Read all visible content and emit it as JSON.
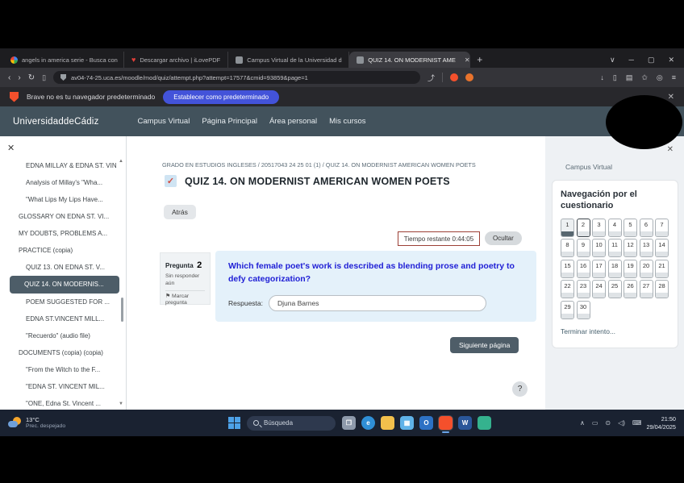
{
  "browser": {
    "tabs": [
      {
        "label": "angels in america serie - Busca con",
        "favicon": "google-favicon",
        "style": "google",
        "active": false
      },
      {
        "label": "Descargar archivo | iLovePDF",
        "favicon": "heart-favicon",
        "style": "heart",
        "active": false
      },
      {
        "label": "Campus Virtual de la Universidad d",
        "favicon": "moodle-favicon",
        "style": "moodle",
        "active": false
      },
      {
        "label": "QUIZ 14. ON MODERNIST AME",
        "favicon": "moodle-favicon",
        "style": "moodle",
        "active": true
      }
    ],
    "new_tab": "+",
    "window_controls": [
      "∨",
      "─",
      "▢",
      "✕"
    ],
    "nav": {
      "back": "‹",
      "forward": "›",
      "reload": "↻"
    },
    "url": "av04-74-25.uca.es/moodle/mod/quiz/attempt.php?attempt=17577&cmid=93859&page=1",
    "share_glyph": "⤴",
    "extensions": [
      {
        "name": "brave-extension-icon",
        "color": "#f4502c"
      },
      {
        "name": "extension-icon",
        "color": "#e8732c"
      }
    ],
    "right_icons": [
      {
        "name": "download-icon",
        "glyph": "↓"
      },
      {
        "name": "split-screen-icon",
        "glyph": "▯"
      },
      {
        "name": "collections-icon",
        "glyph": "▤"
      },
      {
        "name": "favorites-icon",
        "glyph": "✩"
      },
      {
        "name": "browser-essentials-icon",
        "glyph": "◎"
      },
      {
        "name": "menu-icon",
        "glyph": "≡"
      }
    ],
    "notification": {
      "text": "Brave no es tu navegador predeterminado",
      "button": "Establecer como predeterminado",
      "close": "✕"
    }
  },
  "site_header": {
    "logo": "UniversidaddeCádiz",
    "nav": [
      "Campus Virtual",
      "Página Principal",
      "Área personal",
      "Mis cursos"
    ]
  },
  "sidebar": {
    "close": "✕",
    "items": [
      {
        "label": "EDNA MILLAY & EDNA ST. VIN",
        "level": 2,
        "selected": false
      },
      {
        "label": "Analysis of Millay's \"Wha...",
        "level": 2,
        "selected": false
      },
      {
        "label": "\"What Lips My Lips Have...",
        "level": 2,
        "selected": false
      },
      {
        "label": "GLOSSARY ON EDNA ST. VI...",
        "level": 1,
        "selected": false
      },
      {
        "label": "MY DOUBTS, PROBLEMS A...",
        "level": 1,
        "selected": false
      },
      {
        "label": "PRACTICE (copia)",
        "level": 1,
        "selected": false
      },
      {
        "label": "QUIZ 13. ON EDNA ST. V...",
        "level": 2,
        "selected": false
      },
      {
        "label": "QUIZ 14. ON MODERNIS...",
        "level": 2,
        "selected": true
      },
      {
        "label": "POEM SUGGESTED FOR ...",
        "level": 2,
        "selected": false
      },
      {
        "label": "EDNA ST.VINCENT MILL...",
        "level": 2,
        "selected": false
      },
      {
        "label": "\"Recuerdo\" (audio file)",
        "level": 2,
        "selected": false
      },
      {
        "label": "DOCUMENTS (copia) (copia)",
        "level": 1,
        "selected": false
      },
      {
        "label": "\"From the Witch to the F...",
        "level": 2,
        "selected": false
      },
      {
        "label": "\"EDNA ST. VINCENT MIL...",
        "level": 2,
        "selected": false
      },
      {
        "label": "\"ONE, Edna St. Vincent ...",
        "level": 2,
        "selected": false
      }
    ]
  },
  "main": {
    "breadcrumb": "GRADO EN ESTUDIOS INGLESES / 20517043 24 25 01 (1) / QUIZ 14. ON MODERNIST AMERICAN WOMEN POETS",
    "title": "QUIZ 14. ON MODERNIST AMERICAN WOMEN POETS",
    "back_button": "Atrás",
    "timer_label": "Tiempo restante 0:44:05",
    "hide_button": "Ocultar",
    "question": {
      "label": "Pregunta",
      "number": "2",
      "status": "Sin responder aún",
      "flag_label": "Marcar pregunta",
      "text": "Which female poet's work is described as blending prose and poetry to defy categorization?",
      "answer_label": "Respuesta:",
      "answer_value": "Djuna Barnes"
    },
    "next_button": "Siguiente página",
    "help_button": "?"
  },
  "quiz_nav": {
    "context_link": "Campus Virtual",
    "close": "✕",
    "title": "Navegación por el cuestionario",
    "count": 30,
    "answered": [
      1
    ],
    "current": 2,
    "finish_link": "Terminar intento..."
  },
  "taskbar": {
    "temp": "13°C",
    "weather_desc": "Prec. despejado",
    "search_placeholder": "Búsqueda",
    "apps": [
      {
        "name": "task-view-icon",
        "color": "#8e9aab",
        "glyph": "❐"
      },
      {
        "name": "edge-icon",
        "color": "#2f8fd6",
        "glyph": "e"
      },
      {
        "name": "file-explorer-icon",
        "color": "#f2c04c",
        "glyph": ""
      },
      {
        "name": "store-icon",
        "color": "#5fb2e8",
        "glyph": "▦"
      },
      {
        "name": "outlook-icon",
        "color": "#2d71c4",
        "glyph": "O"
      },
      {
        "name": "brave-icon",
        "color": "#f4502c",
        "glyph": "",
        "active": true
      },
      {
        "name": "word-icon",
        "color": "#2a5699",
        "glyph": "W"
      },
      {
        "name": "green-app-icon",
        "color": "#35b28e",
        "glyph": ""
      }
    ],
    "tray": [
      {
        "name": "tray-chevron-up-icon",
        "glyph": "∧"
      },
      {
        "name": "tray-device-icon",
        "glyph": "▭"
      },
      {
        "name": "tray-location-icon",
        "glyph": "⊙"
      },
      {
        "name": "tray-volume-icon",
        "glyph": "◁)"
      },
      {
        "name": "tray-keyboard-icon",
        "glyph": "⌨"
      }
    ],
    "time": "21:50",
    "date": "29/04/2025"
  },
  "colors": {
    "header_slate": "#42525c",
    "question_text_blue": "#2121d6",
    "timer_border_red": "#9c4036",
    "notification_button_blue": "#4353d9",
    "brave_red": "#f4502c",
    "selected_item_slate": "#4d5d68"
  }
}
